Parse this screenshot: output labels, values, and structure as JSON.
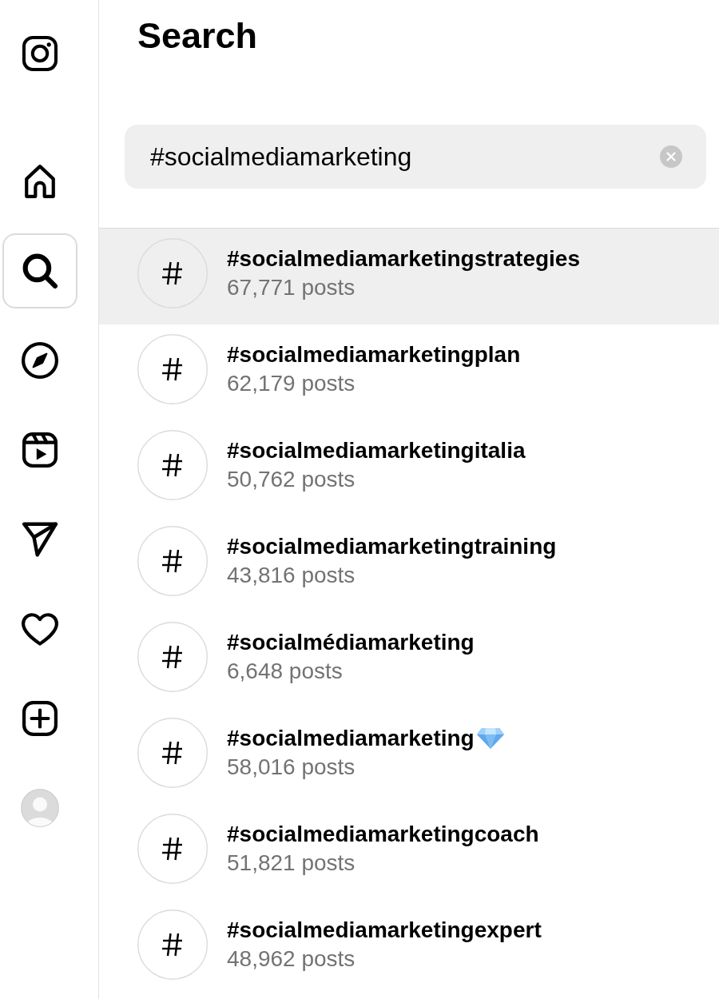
{
  "sidebar": {
    "items": [
      {
        "kind": "home",
        "selected": false
      },
      {
        "kind": "search",
        "selected": true
      },
      {
        "kind": "explore",
        "selected": false
      },
      {
        "kind": "reels",
        "selected": false
      },
      {
        "kind": "messages",
        "selected": false
      },
      {
        "kind": "notifications",
        "selected": false
      },
      {
        "kind": "create",
        "selected": false
      },
      {
        "kind": "profile",
        "selected": false
      }
    ]
  },
  "search_panel": {
    "title": "Search",
    "query": "#socialmediamarketing",
    "results": [
      {
        "kind": "hashtag",
        "name": "#socialmediamarketingstrategies",
        "count": "67,771 posts",
        "gem_emoji": false,
        "selected": true
      },
      {
        "kind": "hashtag",
        "name": "#socialmediamarketingplan",
        "count": "62,179 posts",
        "gem_emoji": false,
        "selected": false
      },
      {
        "kind": "hashtag",
        "name": "#socialmediamarketingitalia",
        "count": "50,762 posts",
        "gem_emoji": false,
        "selected": false
      },
      {
        "kind": "hashtag",
        "name": "#socialmediamarketingtraining",
        "count": "43,816 posts",
        "gem_emoji": false,
        "selected": false
      },
      {
        "kind": "hashtag",
        "name": "#socialmédiamarketing",
        "count": "6,648 posts",
        "gem_emoji": false,
        "selected": false
      },
      {
        "kind": "hashtag",
        "name": "#socialmediamarketing",
        "count": "58,016 posts",
        "gem_emoji": true,
        "selected": false
      },
      {
        "kind": "hashtag",
        "name": "#socialmediamarketingcoach",
        "count": "51,821 posts",
        "gem_emoji": false,
        "selected": false
      },
      {
        "kind": "hashtag",
        "name": "#socialmediamarketingexpert",
        "count": "48,962 posts",
        "gem_emoji": false,
        "selected": false
      }
    ]
  }
}
